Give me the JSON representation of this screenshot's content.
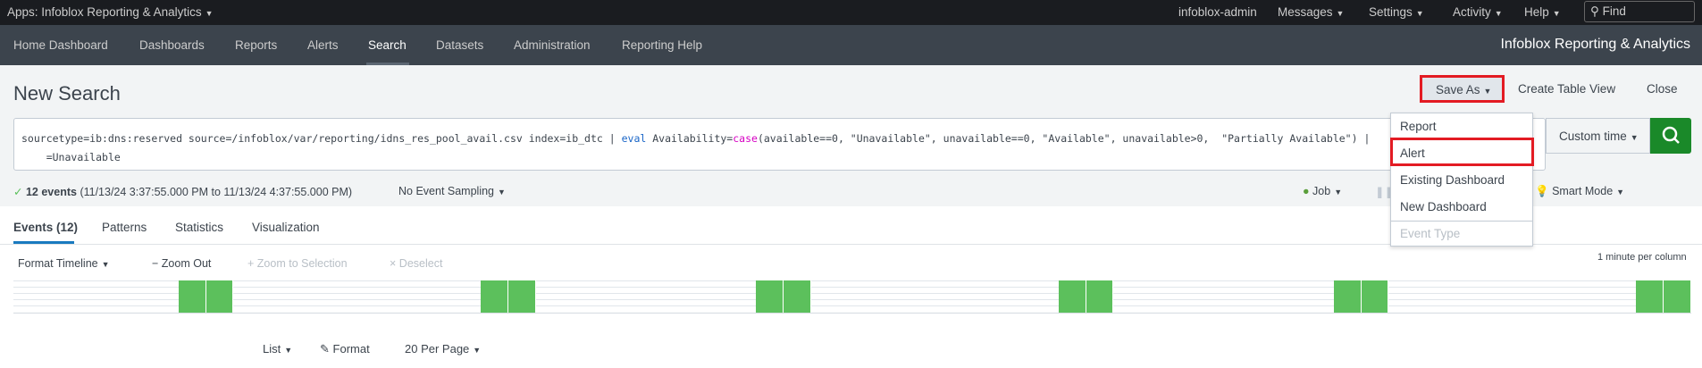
{
  "topbar": {
    "app": "Apps: Infoblox Reporting & Analytics",
    "user": "infoblox-admin",
    "messages": "Messages",
    "settings": "Settings",
    "activity": "Activity",
    "help": "Help",
    "find_placeholder": "Find"
  },
  "nav": {
    "items": [
      "Home Dashboard",
      "Dashboards",
      "Reports",
      "Alerts",
      "Search",
      "Datasets",
      "Administration",
      "Reporting Help"
    ],
    "active": "Search",
    "brand": "Infoblox Reporting & Analytics"
  },
  "header": {
    "title": "New Search",
    "save_as": "Save As",
    "create_table_view": "Create Table View",
    "close": "Close"
  },
  "search": {
    "query_part1": "sourcetype=ib:dns:reserved source=/infoblox/var/reporting/idns_res_pool_avail.csv index=ib_dtc | ",
    "kw_eval": "eval",
    "query_part2": " Availability=",
    "fn_case": "case",
    "query_part3": "(available==0, \"Unavailable\", unavailable==0, \"Available\", unavailable>0,  \"Partially Available\") |",
    "query_line2": "=Unavailable",
    "time_range": "Custom time",
    "accent": "#1a8929"
  },
  "status": {
    "events": "12 events",
    "range": "(11/13/24 3:37:55.000 PM to 11/13/24 4:37:55.000 PM)",
    "sampling": "No Event Sampling",
    "job": "Job",
    "mode": "Smart Mode"
  },
  "tabs": [
    "Events (12)",
    "Patterns",
    "Statistics",
    "Visualization"
  ],
  "timeline_toolbar": {
    "format": "Format Timeline",
    "zoom_out": "Zoom Out",
    "zoom_selection": "Zoom to Selection",
    "deselect": "Deselect",
    "scale": "1 minute per column"
  },
  "timeline": {
    "start": "3:37 PM",
    "end": "4:37 PM",
    "bins": [
      {
        "time": "3:43 PM",
        "count": 1
      },
      {
        "time": "3:44 PM",
        "count": 1
      },
      {
        "time": "3:54 PM",
        "count": 1
      },
      {
        "time": "3:55 PM",
        "count": 1
      },
      {
        "time": "4:04 PM",
        "count": 1
      },
      {
        "time": "4:05 PM",
        "count": 1
      },
      {
        "time": "4:15 PM",
        "count": 1
      },
      {
        "time": "4:16 PM",
        "count": 1
      },
      {
        "time": "4:25 PM",
        "count": 1
      },
      {
        "time": "4:26 PM",
        "count": 1
      },
      {
        "time": "4:36 PM",
        "count": 1
      },
      {
        "time": "4:37 PM",
        "count": 1
      }
    ],
    "color": "#5cc05c"
  },
  "results_toolbar": {
    "list": "List",
    "format": "Format",
    "per_page": "20 Per Page"
  },
  "save_menu": {
    "items": [
      "Report",
      "Alert",
      "Existing Dashboard",
      "New Dashboard"
    ],
    "disabled": "Event Type",
    "highlighted": "Alert",
    "highlight_color": "#e31b23"
  }
}
